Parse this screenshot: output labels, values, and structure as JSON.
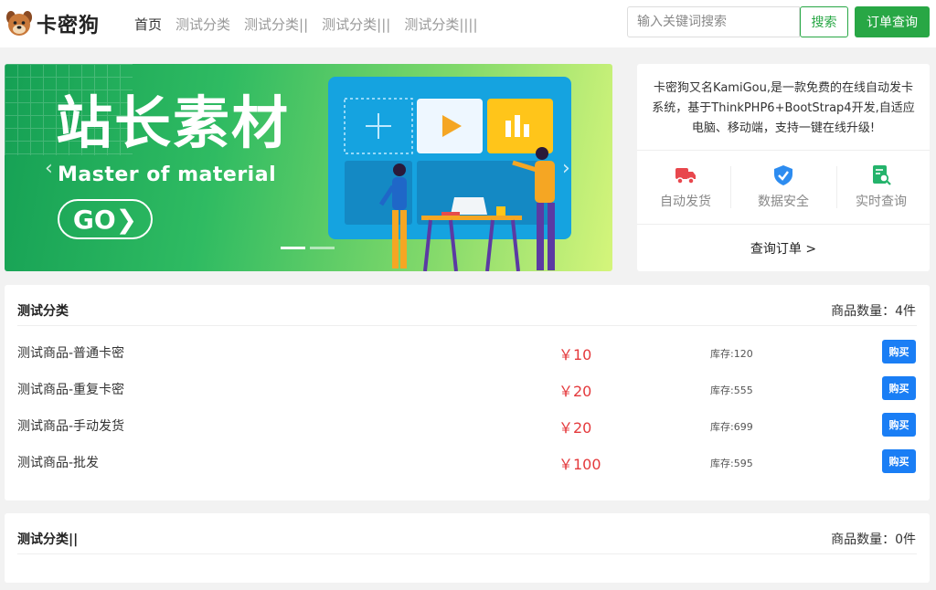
{
  "header": {
    "logo_text": "卡密狗",
    "logo_icon": "dog-face-icon",
    "nav": [
      {
        "label": "首页"
      },
      {
        "label": "测试分类"
      },
      {
        "label": "测试分类||"
      },
      {
        "label": "测试分类|||"
      },
      {
        "label": "测试分类||||"
      }
    ],
    "search_placeholder": "输入关键词搜索",
    "search_button": "搜索",
    "order_button": "订单查询",
    "accent_color": "#28a745"
  },
  "banner": {
    "title": "站长素材",
    "subtitle": "Master of material",
    "go_label": "GO❯",
    "prev_label": "‹",
    "next_label": "›"
  },
  "info": {
    "description": "卡密狗又名KamiGou,是一款免费的在线自动发卡系统，基于ThinkPHP6+BootStrap4开发,自适应电脑、移动端，支持一键在线升级!",
    "features": [
      {
        "icon": "delivery-truck-icon",
        "label": "自动发货"
      },
      {
        "icon": "shield-check-icon",
        "label": "数据安全"
      },
      {
        "icon": "document-search-icon",
        "label": "实时查询"
      }
    ],
    "link_label": "查询订单 >"
  },
  "categories": [
    {
      "title": "测试分类",
      "count_label": "商品数量：4件",
      "products": [
        {
          "name": "测试商品-普通卡密",
          "price": "￥10",
          "stock": "库存:120",
          "buy": "购买"
        },
        {
          "name": "测试商品-重复卡密",
          "price": "￥20",
          "stock": "库存:555",
          "buy": "购买"
        },
        {
          "name": "测试商品-手动发货",
          "price": "￥20",
          "stock": "库存:699",
          "buy": "购买"
        },
        {
          "name": "测试商品-批发",
          "price": "￥100",
          "stock": "库存:595",
          "buy": "购买"
        }
      ]
    },
    {
      "title": "测试分类||",
      "count_label": "商品数量：0件",
      "products": []
    }
  ],
  "colors": {
    "price": "#e4393c",
    "buy_button": "#1a7ef5",
    "page_background": "#f2f2f2"
  }
}
